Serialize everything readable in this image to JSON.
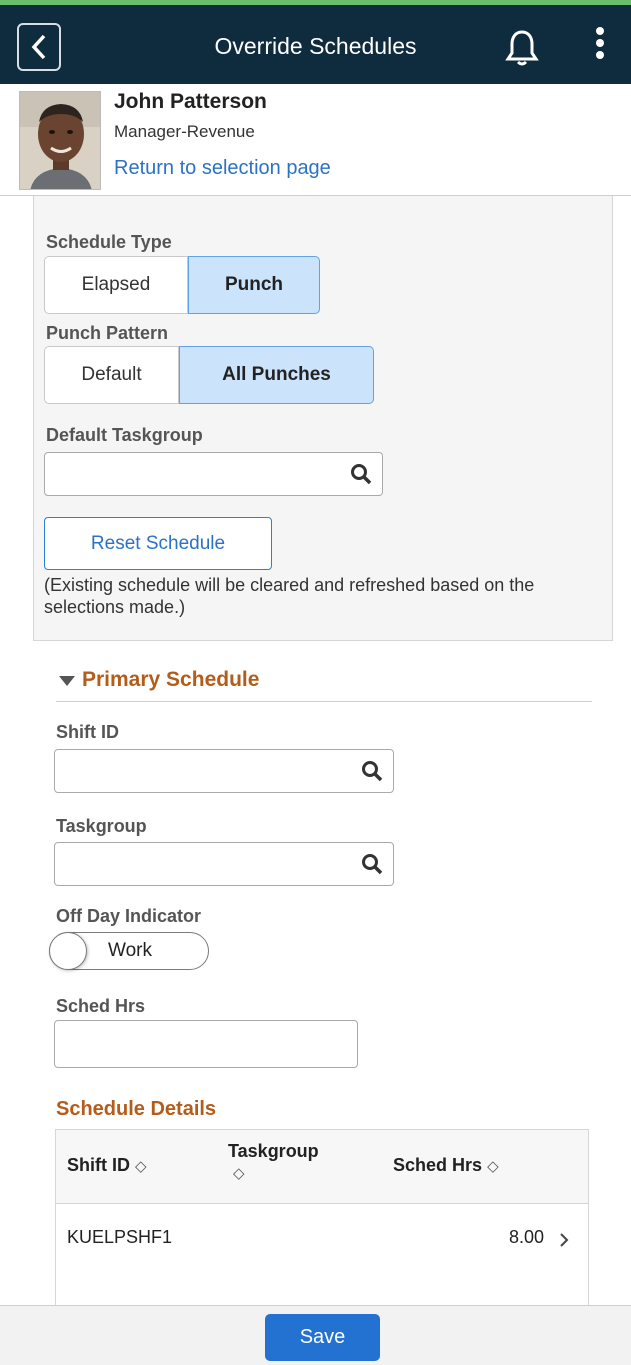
{
  "header": {
    "title": "Override Schedules",
    "back_icon": "chevron-left-icon",
    "bell_icon": "bell-icon",
    "more_icon": "more-vertical-icon"
  },
  "profile": {
    "name": "John Patterson",
    "role": "Manager-Revenue",
    "link": "Return to selection page"
  },
  "schedule_type": {
    "label": "Schedule Type",
    "options": [
      "Elapsed",
      "Punch"
    ],
    "selected": "Punch"
  },
  "punch_pattern": {
    "label": "Punch Pattern",
    "options": [
      "Default",
      "All Punches"
    ],
    "selected": "All Punches"
  },
  "default_taskgroup": {
    "label": "Default Taskgroup",
    "value": ""
  },
  "reset": {
    "label": "Reset Schedule",
    "note": "(Existing schedule will be cleared and refreshed based on the selections made.)"
  },
  "primary_schedule": {
    "title": "Primary Schedule",
    "shift_id": {
      "label": "Shift ID",
      "value": ""
    },
    "taskgroup": {
      "label": "Taskgroup",
      "value": ""
    },
    "off_day": {
      "label": "Off Day Indicator",
      "state": "Work"
    },
    "sched_hrs": {
      "label": "Sched Hrs",
      "value": ""
    }
  },
  "schedule_details": {
    "title": "Schedule Details",
    "columns": [
      "Shift ID",
      "Taskgroup",
      "Sched Hrs"
    ],
    "rows": [
      {
        "shift_id": "KUELPSHF1",
        "taskgroup": "",
        "sched_hrs": "8.00"
      }
    ]
  },
  "footer": {
    "save_label": "Save"
  },
  "colors": {
    "header_bg": "#0f2b3e",
    "accent_blue": "#2372d1",
    "section_orange": "#b45d1b",
    "selected_bg": "#cbe4fb"
  }
}
